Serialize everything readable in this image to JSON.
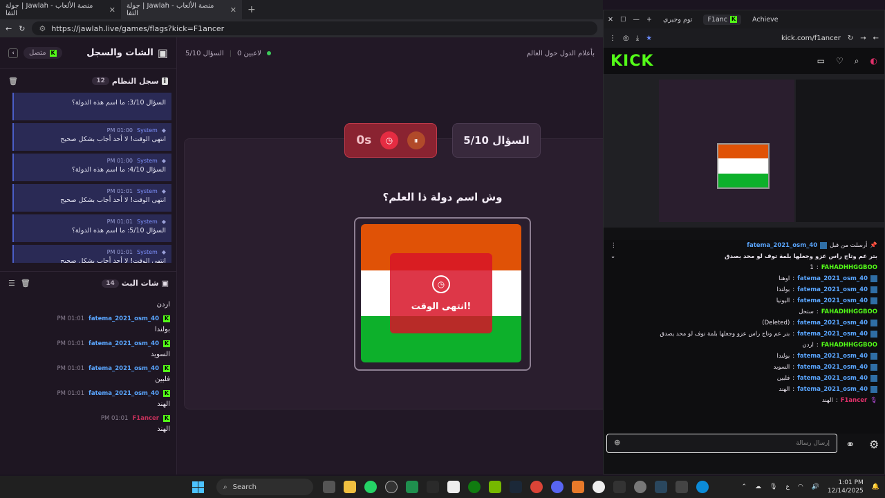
{
  "browser": {
    "tabs": [
      {
        "title": "جولة | Jawlah - منصة الألعاب التفا",
        "active": false
      },
      {
        "title": "جولة | Jawlah - منصة الألعاب التفا",
        "active": true
      }
    ],
    "url": "https://jawlah.live/games/flags?kick=F1ancer"
  },
  "sidebar": {
    "title": "الشات والسجل",
    "status": "متصل",
    "system_section": {
      "title": "سجل النظام",
      "count": "12"
    },
    "system_items": [
      {
        "who": "System",
        "time": "PM 01:00",
        "text": "السؤال 3/10: ما اسم هذه الدولة؟"
      },
      {
        "who": "System",
        "time": "PM 01:00",
        "text": "انتهى الوقت! لا أحد أجاب بشكل صحيح"
      },
      {
        "who": "System",
        "time": "PM 01:00",
        "text": "السؤال 4/10: ما اسم هذه الدولة؟"
      },
      {
        "who": "System",
        "time": "PM 01:01",
        "text": "انتهى الوقت! لا أحد أجاب بشكل صحيح"
      },
      {
        "who": "System",
        "time": "PM 01:01",
        "text": "السؤال 5/10: ما اسم هذه الدولة؟"
      },
      {
        "who": "System",
        "time": "PM 01:01",
        "text": "انتهى الوقت! لا أحد أجاب بشكل صحيح"
      }
    ],
    "chat_section": {
      "title": "شات البث",
      "count": "14"
    },
    "chat_items": [
      {
        "user": "",
        "time": "",
        "text": "اردن"
      },
      {
        "user": "fatema_2021_osm_40",
        "time": "PM 01:01",
        "text": "بولندا"
      },
      {
        "user": "fatema_2021_osm_40",
        "time": "PM 01:01",
        "text": "السويد"
      },
      {
        "user": "fatema_2021_osm_40",
        "time": "PM 01:01",
        "text": "فلبين"
      },
      {
        "user": "fatema_2021_osm_40",
        "time": "PM 01:01",
        "text": "الهند"
      },
      {
        "user": "F1ancer",
        "time": "PM 01:01",
        "text": "الهند"
      }
    ]
  },
  "game": {
    "players": "0 لاعبين",
    "question_short": "السؤال 5/10",
    "subtitle": "بأعلام الدول حول العالم",
    "question_counter": "السؤال 5/10",
    "timer": "0s",
    "question": "وش اسم دولة ذا العلم؟",
    "overlay_text": "انتهى الوقت!",
    "flag_colors": [
      "#e05206",
      "#ffffff",
      "#0db02b"
    ]
  },
  "kick": {
    "tabs": [
      "F1anc",
      "Achieve",
      "توم وجيري"
    ],
    "url": "kick.com/f1ancer",
    "logo": "KICK",
    "pinned_user": "fatema_2021_osm_40",
    "pinned_label": "أرسلت من قبل",
    "pinned_text": "بتر عم وتاج راس عزو وجعلها بلمة توف لو محد يصدق",
    "messages": [
      {
        "user": "FAHADHHGGBOO",
        "text": "1",
        "style": "green"
      },
      {
        "user": "fatema_2021_osm_40",
        "text": "اوهنا",
        "style": "blue"
      },
      {
        "user": "fatema_2021_osm_40",
        "text": "بولندا",
        "style": "blue"
      },
      {
        "user": "fatema_2021_osm_40",
        "text": "اليونيا",
        "style": "blue"
      },
      {
        "user": "FAHADHHGGBOO",
        "text": "ستحل",
        "style": "green"
      },
      {
        "user": "fatema_2021_osm_40",
        "text": "(Deleted)",
        "style": "blue"
      },
      {
        "user": "fatema_2021_osm_40",
        "text": "بتر عم وتاج راس عزو وجعلها بلمة توف لو محد يصدق",
        "style": "blue"
      },
      {
        "user": "FAHADHHGGBOO",
        "text": "اردن",
        "style": "green"
      },
      {
        "user": "fatema_2021_osm_40",
        "text": "بولندا",
        "style": "blue"
      },
      {
        "user": "fatema_2021_osm_40",
        "text": "السويد",
        "style": "blue"
      },
      {
        "user": "fatema_2021_osm_40",
        "text": "فلبين",
        "style": "blue"
      },
      {
        "user": "fatema_2021_osm_40",
        "text": "الهند",
        "style": "blue"
      },
      {
        "user": "F1ancer",
        "text": "الهند",
        "style": "pink"
      }
    ],
    "input_placeholder": "إرسال رسالة"
  },
  "taskbar": {
    "search_label": "Search",
    "time": "1:01 PM",
    "date": "12/14/2025",
    "lang": "ع"
  }
}
